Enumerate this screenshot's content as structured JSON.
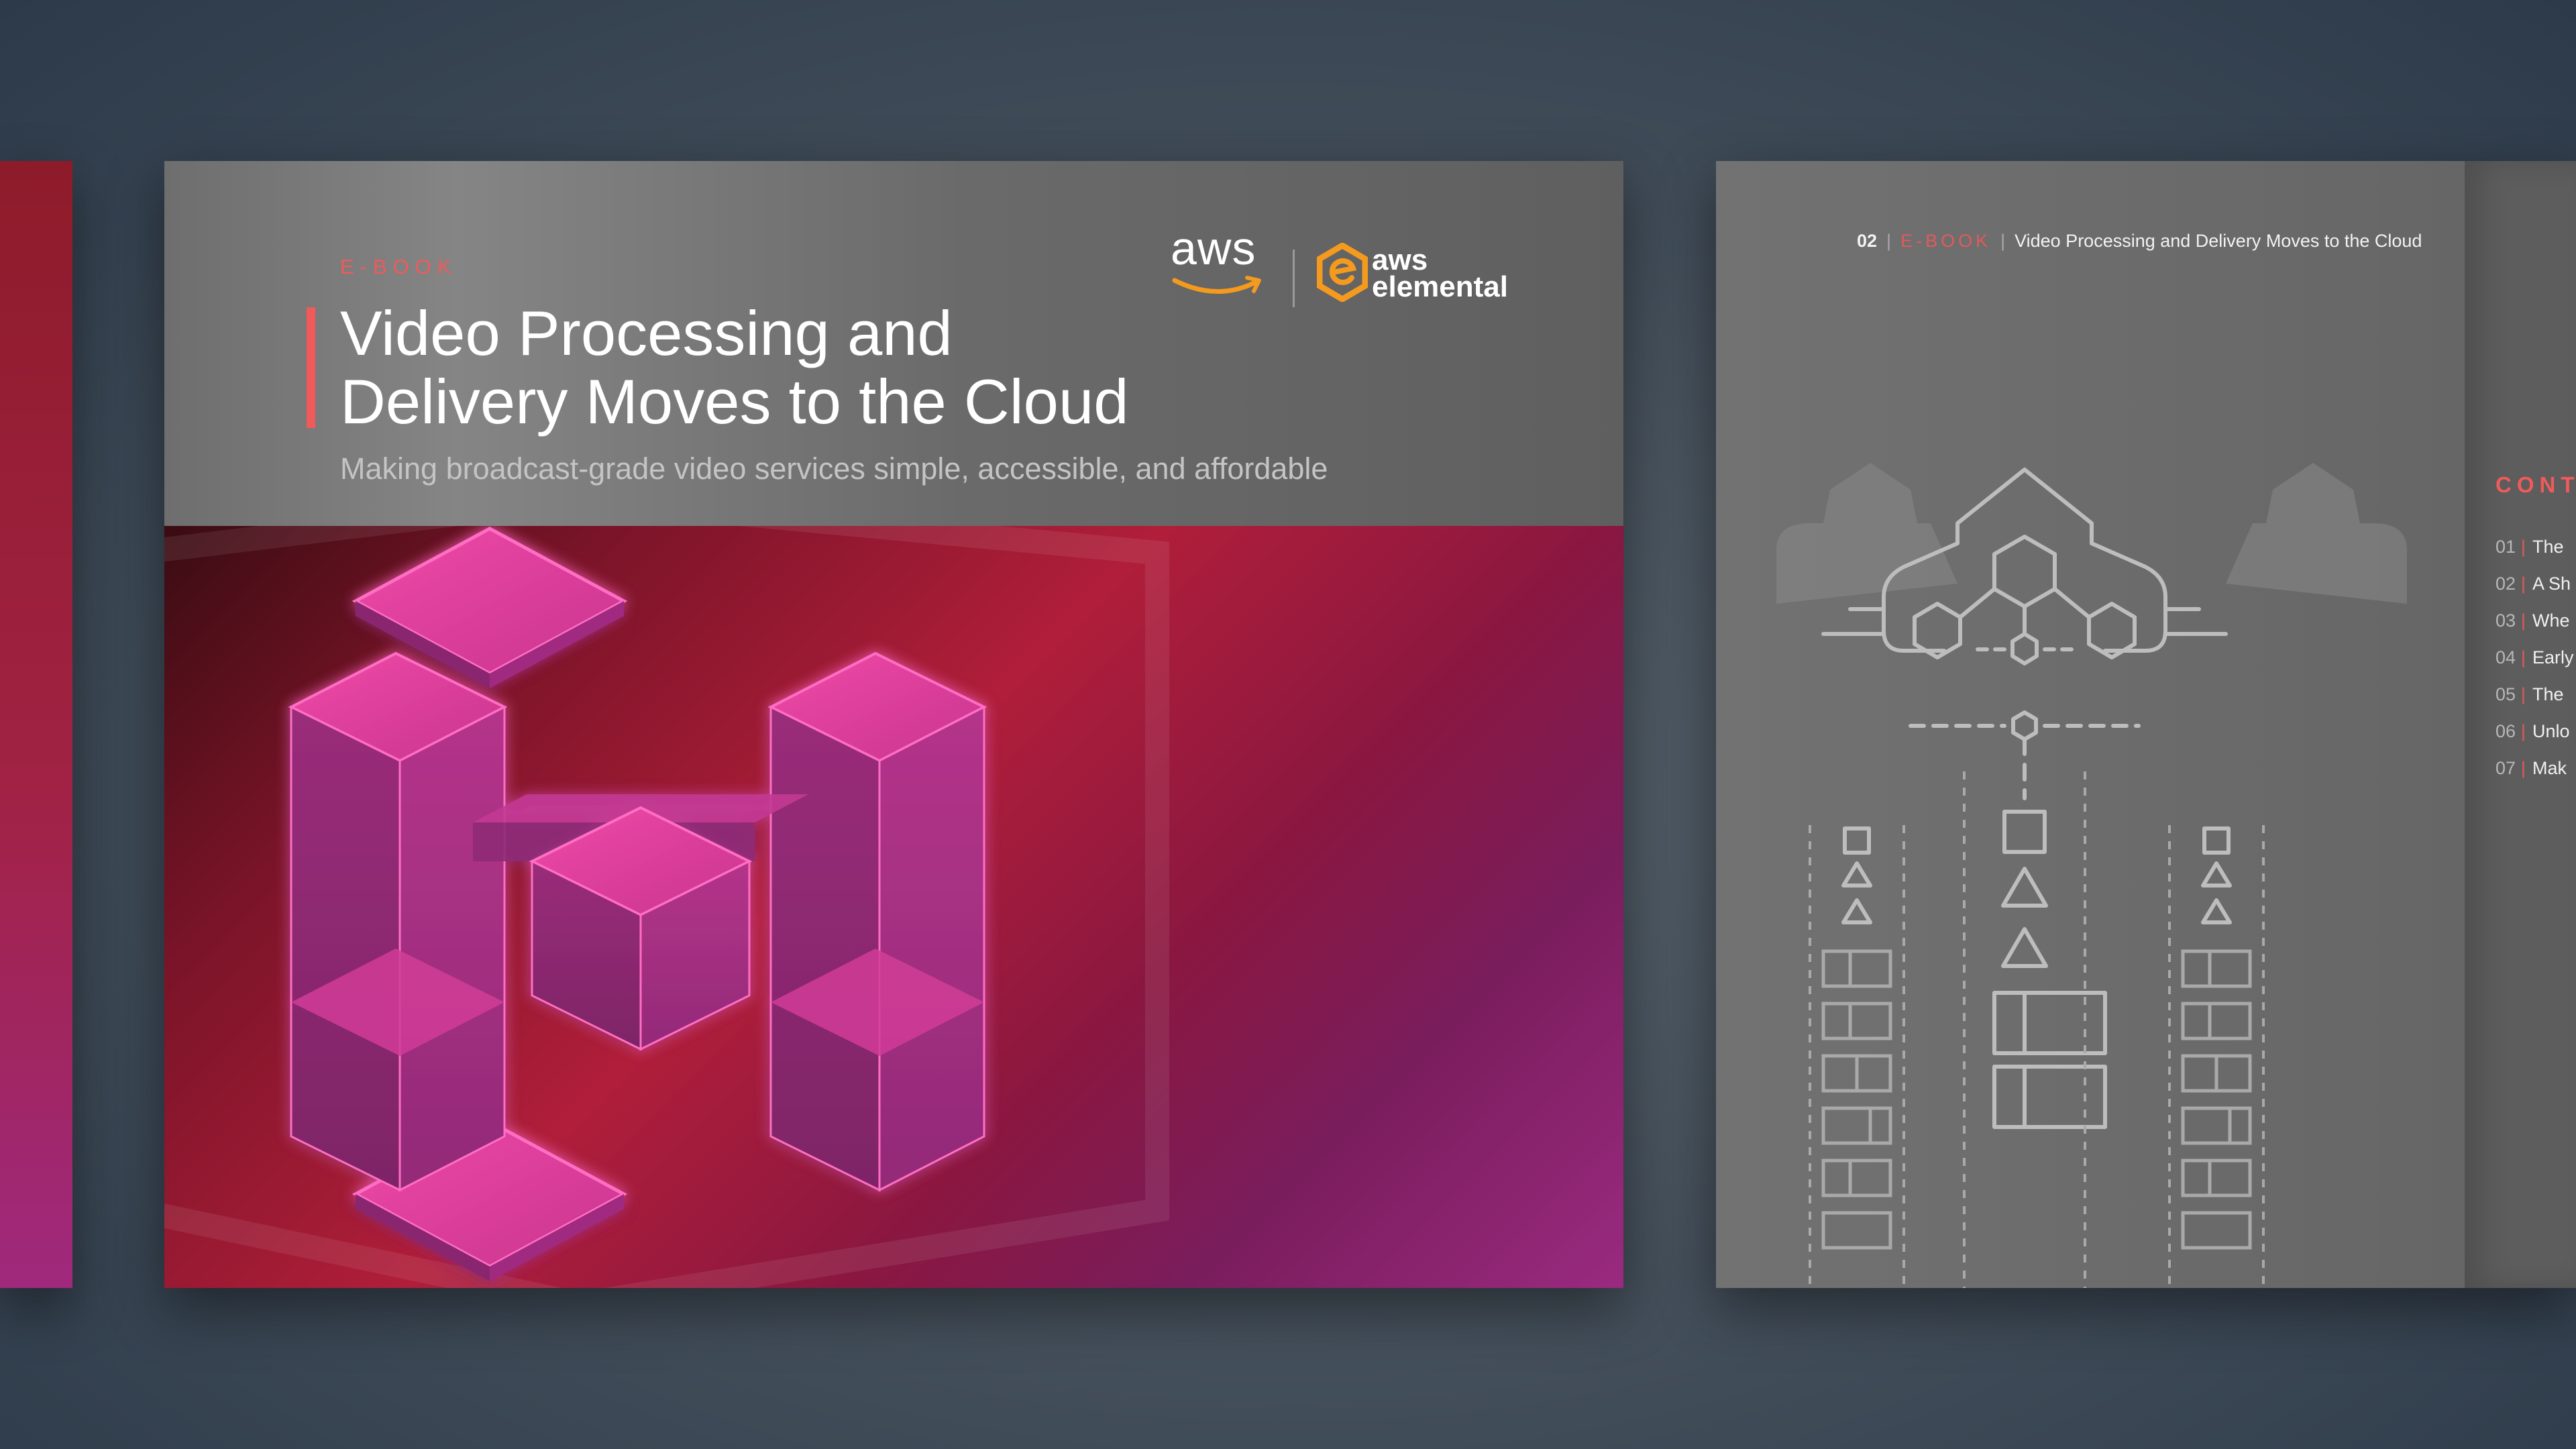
{
  "cover": {
    "eyebrow": "E-BOOK",
    "title_line1": "Video Processing and",
    "title_line2": "Delivery Moves to the Cloud",
    "subtitle": "Making broadcast-grade video services simple, accessible, and affordable",
    "logos": {
      "aws": "aws",
      "elemental_line1": "aws",
      "elemental_line2": "elemental"
    }
  },
  "spread": {
    "page_number": "02",
    "eyebrow": "E-BOOK",
    "running_title": "Video Processing and Delivery Moves to the Cloud",
    "toc_heading": "CONT",
    "toc": [
      {
        "num": "01",
        "label": "The"
      },
      {
        "num": "02",
        "label": "A Sh"
      },
      {
        "num": "03",
        "label": "Whe"
      },
      {
        "num": "04",
        "label": "Early"
      },
      {
        "num": "05",
        "label": "The"
      },
      {
        "num": "06",
        "label": "Unlo"
      },
      {
        "num": "07",
        "label": "Mak"
      }
    ]
  },
  "colors": {
    "accent": "#f15a5a",
    "aws_orange": "#f39a1f",
    "cube_pink": "#e0409a"
  },
  "icons": [
    "aws-smile-logo",
    "elemental-hexagon-logo",
    "cloud-network-icon",
    "video-stream-illustration",
    "hexagon-cubes-illustration"
  ]
}
